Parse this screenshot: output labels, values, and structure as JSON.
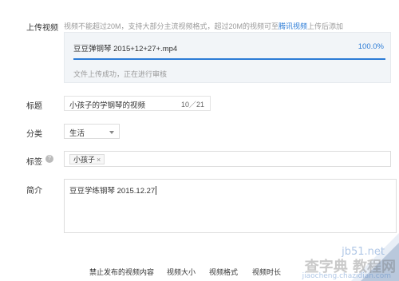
{
  "form": {
    "upload": {
      "label": "上传视频",
      "hint_prefix": "视频不能超过20M，支持大部分主流视频格式，超过20M的视频可至",
      "hint_link": "腾讯视频",
      "hint_suffix": "上传后添加",
      "file_name": "豆豆弹钢琴 2015+12+27+.mp4",
      "percent_text": "100.0%",
      "progress": 1.0,
      "status": "文件上传成功，正在进行审核"
    },
    "title": {
      "label": "标题",
      "value": "小孩子的学钢琴的视频",
      "count": "10／21"
    },
    "category": {
      "label": "分类",
      "value": "生活"
    },
    "tags": {
      "label": "标签",
      "help_glyph": "?",
      "items": [
        {
          "text": "小孩子",
          "remove": "×"
        }
      ]
    },
    "description": {
      "label": "简介",
      "value": "豆豆学练钢琴 2015.12.27"
    }
  },
  "bottom_tabs": [
    "禁止发布的视频内容",
    "视频大小",
    "视频格式",
    "视频时长"
  ],
  "watermark": {
    "line1": "jb51.net",
    "line2": "查字典 教程网",
    "line3": "jiaocheng.chazidian.com"
  },
  "colors": {
    "accent": "#2b7bd6",
    "upload_bg": "#f2f5f8",
    "fold_light": "#e8eef6",
    "fold_dark": "#b9c8dc"
  }
}
